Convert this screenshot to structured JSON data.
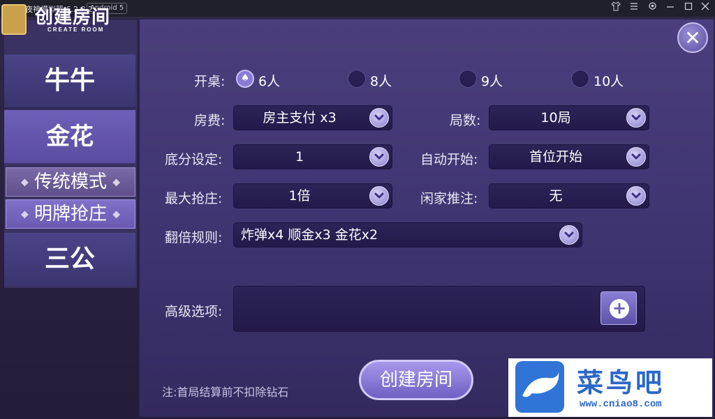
{
  "titlebar": {
    "logo": "nox",
    "app_name": "夜神模拟器 6.2.8.2",
    "android": "Android 5",
    "icons": [
      "shirt-icon",
      "menu-icon",
      "settings-icon",
      "minimize-icon",
      "maximize-icon",
      "close-icon"
    ]
  },
  "sidebar": {
    "logo_title": "创建房间",
    "logo_subtitle": "CREATE ROOM",
    "items": [
      {
        "label": "牛牛"
      },
      {
        "label": "金花"
      },
      {
        "label": "传统模式"
      },
      {
        "label": "明牌抢庄"
      },
      {
        "label": "三公"
      }
    ],
    "diamond": "◆"
  },
  "form": {
    "table_label": "开桌:",
    "table_options": [
      {
        "label": "6人",
        "selected": true
      },
      {
        "label": "8人",
        "selected": false
      },
      {
        "label": "9人",
        "selected": false
      },
      {
        "label": "10人",
        "selected": false
      }
    ],
    "fee_label": "房费:",
    "fee_value": "房主支付 x3",
    "rounds_label": "局数:",
    "rounds_value": "10局",
    "base_label": "底分设定:",
    "base_value": "1",
    "autostart_label": "自动开始:",
    "autostart_value": "首位开始",
    "max_grab_label": "最大抢庄:",
    "max_grab_value": "1倍",
    "idle_bet_label": "闲家推注:",
    "idle_bet_value": "无",
    "double_label": "翻倍规则:",
    "double_value": "炸弹x4  顺金x3  金花x2",
    "advanced_label": "高级选项:"
  },
  "buttons": {
    "close": "✕",
    "plus": "+",
    "create": "创建房间"
  },
  "note": "注:首局结算前不扣除钻石",
  "watermark": {
    "text": "菜鸟吧",
    "url": "www.cniao8.com"
  },
  "colors": {
    "panel": "#3e3470",
    "sidebar": "#3a3262",
    "accent": "#8a7ad8",
    "dropdown": "#231a4a"
  }
}
